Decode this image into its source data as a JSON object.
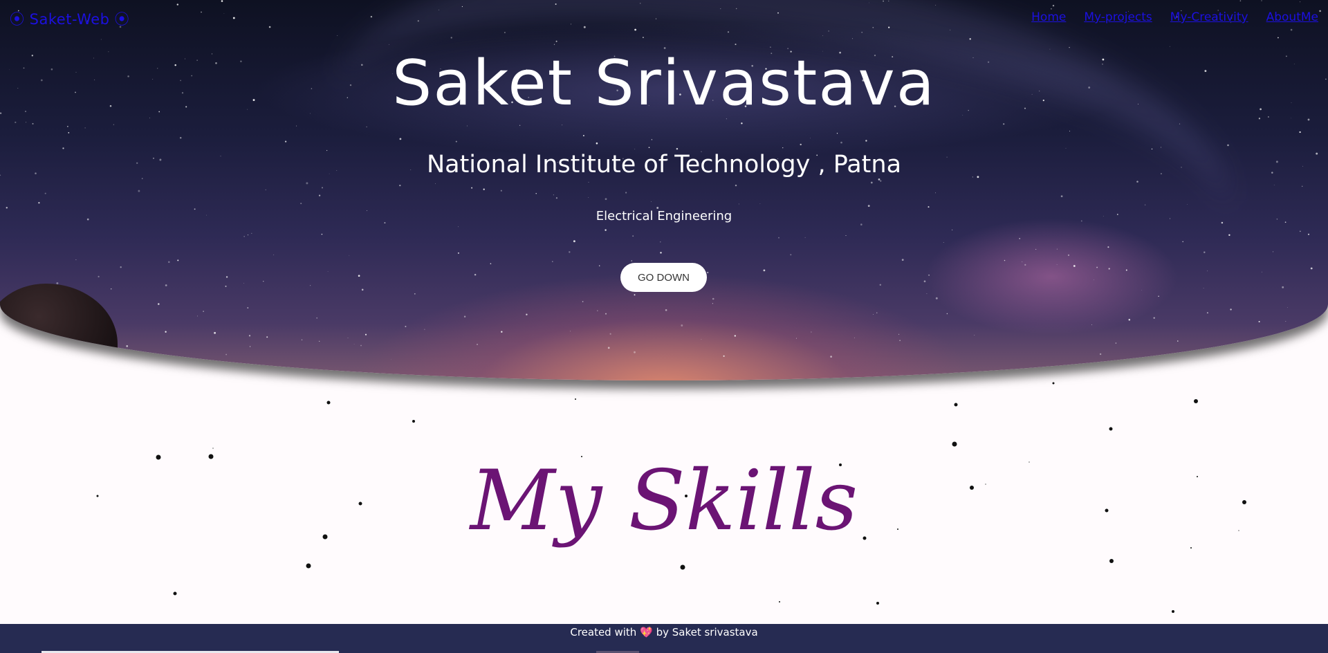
{
  "nav": {
    "brand": "⦿ Saket-Web ⦿",
    "links": [
      "Home",
      "My-projects",
      "My-Creativity",
      "AboutMe"
    ]
  },
  "hero": {
    "name": "Saket Srivastava",
    "institute": "National Institute of Technology , Patna",
    "branch": "Electrical Engineering",
    "button": "GO DOWN"
  },
  "skills": {
    "title": "My Skills"
  },
  "footer": {
    "prefix": "Created with",
    "heart": "💖",
    "suffix": "by Saket srivastava"
  },
  "colors": {
    "nav_link": "#1c10e0",
    "skills_title": "#6b1474",
    "footer_bg": "#262b52"
  }
}
